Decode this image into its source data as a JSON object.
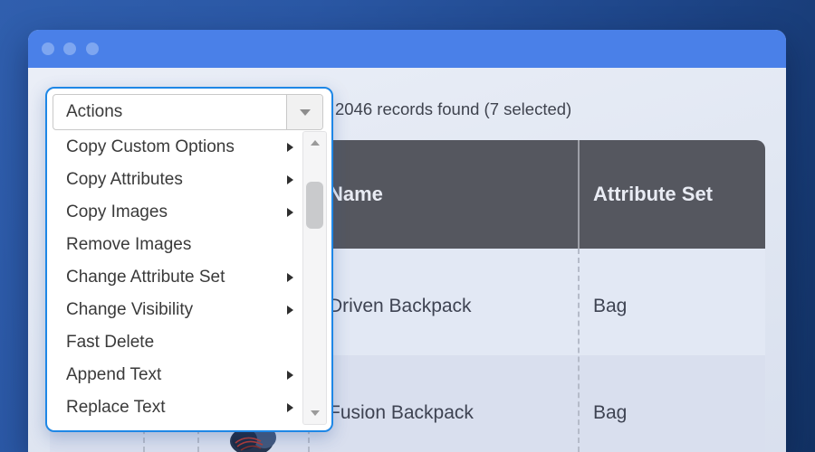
{
  "colors": {
    "backdrop_gradient_start": "#305fae",
    "backdrop_gradient_end": "#123264",
    "titlebar_blue": "#4a80e8",
    "titlebar_dot_blue": "#7ea6f0",
    "dropdown_border_blue": "#1e87e6",
    "table_header_gray": "#55575f",
    "table_header_text": "#e9ecf4",
    "row_light_bg": "#e2e8f4",
    "row_dark_bg": "#d9dfee",
    "row_text": "#3e4352"
  },
  "toolbar": {
    "actions_label": "Actions",
    "records_summary": "2046 records found (7 selected)"
  },
  "action_menu": {
    "items": [
      {
        "label": "Copy Custom Options",
        "has_submenu": true
      },
      {
        "label": "Copy Attributes",
        "has_submenu": true
      },
      {
        "label": "Copy Images",
        "has_submenu": true
      },
      {
        "label": "Remove Images",
        "has_submenu": false
      },
      {
        "label": "Change Attribute Set",
        "has_submenu": true
      },
      {
        "label": "Change Visibility",
        "has_submenu": true
      },
      {
        "label": "Fast Delete",
        "has_submenu": false
      },
      {
        "label": "Append Text",
        "has_submenu": true
      },
      {
        "label": "Replace Text",
        "has_submenu": true
      }
    ]
  },
  "table": {
    "columns": [
      {
        "label": "Name"
      },
      {
        "label": "Attribute Set"
      }
    ],
    "rows": [
      {
        "name": "Driven Backpack",
        "attribute_set": "Bag"
      },
      {
        "name": "Fusion Backpack",
        "attribute_set": "Bag"
      }
    ]
  }
}
